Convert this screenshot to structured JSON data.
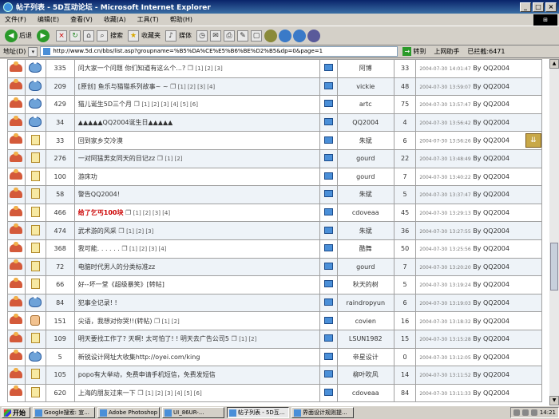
{
  "window": {
    "title": "帖子列表 - 5D互动论坛 - Microsoft Internet Explorer"
  },
  "menu": [
    "文件(F)",
    "编辑(E)",
    "查看(V)",
    "收藏(A)",
    "工具(T)",
    "帮助(H)"
  ],
  "toolbar": {
    "back": "后退",
    "search": "搜索",
    "favorites": "收藏夹",
    "media": "媒体"
  },
  "address": {
    "label": "地址(D)",
    "url": "http://www.5d.cn/bbs/list.asp?groupname=%B5%DA%CE%E5%B6%BE%D2%B5&dp=0&page=1",
    "go": "转到",
    "help": "上网助手",
    "blocked": "已拦截:6471"
  },
  "rows": [
    {
      "id": 335,
      "title": "问大家一个问题 你们知道有这么个...?",
      "pages": "[1] [2] [3]",
      "author": "阿博",
      "replies": 33,
      "date": "2004-07-30",
      "time": "14:01:47",
      "by": "By QQ2004",
      "icon": "face"
    },
    {
      "id": 209,
      "title": "[原创]  鱼乐与猫猫系列故事~ ~",
      "pages": "[1] [2] [3] [4]",
      "author": "vickie",
      "replies": 48,
      "date": "2004-07-30",
      "time": "13:59:07",
      "by": "By QQ2004",
      "icon": "face"
    },
    {
      "id": 429,
      "title": "猫儿诞生5D三个月",
      "pages": "[1] [2] [3] [4] [5] [6]",
      "author": "artc",
      "replies": 75,
      "date": "2004-07-30",
      "time": "13:57:47",
      "by": "By QQ2004",
      "icon": "face"
    },
    {
      "id": 34,
      "title": "▲▲▲▲▲QQ2004诞生日▲▲▲▲▲",
      "pages": "",
      "author": "QQ2004",
      "replies": 4,
      "date": "2004-07-30",
      "time": "13:56:42",
      "by": "By QQ2004",
      "icon": "face"
    },
    {
      "id": 33,
      "title": "回到家乡交冷漠",
      "pages": "",
      "author": "朱斌",
      "replies": 6,
      "date": "2004-07-30",
      "time": "13:56:26",
      "by": "By QQ2004",
      "icon": "doc",
      "down": true
    },
    {
      "id": 276,
      "title": "一对阿猛男女同天的日记zz",
      "pages": "[1] [2]",
      "author": "gourd",
      "replies": 22,
      "date": "2004-07-30",
      "time": "13:48:49",
      "by": "By QQ2004",
      "icon": "doc"
    },
    {
      "id": 100,
      "title": "游床功",
      "pages": "",
      "author": "gourd",
      "replies": 7,
      "date": "2004-07-30",
      "time": "13:40:22",
      "by": "By QQ2004",
      "icon": "doc"
    },
    {
      "id": 58,
      "title": "警告QQ2004!",
      "pages": "",
      "author": "朱斌",
      "replies": 5,
      "date": "2004-07-30",
      "time": "13:37:47",
      "by": "By QQ2004",
      "icon": "doc"
    },
    {
      "id": 466,
      "title": "给了乞丐100块",
      "pages": "[1] [2] [3] [4]",
      "author": "cdoveaa",
      "replies": 45,
      "date": "2004-07-30",
      "time": "13:29:13",
      "by": "By QQ2004",
      "icon": "doc",
      "hot": true
    },
    {
      "id": 474,
      "title": "武术游的风采",
      "pages": "[1] [2] [3]",
      "author": "朱斌",
      "replies": 36,
      "date": "2004-07-30",
      "time": "13:27:55",
      "by": "By QQ2004",
      "icon": "doc"
    },
    {
      "id": 368,
      "title": "我可能. . . . . .",
      "pages": "[1] [2] [3] [4]",
      "author": "酷舞",
      "replies": 50,
      "date": "2004-07-30",
      "time": "13:25:56",
      "by": "By QQ2004",
      "icon": "doc"
    },
    {
      "id": 72,
      "title": "电脑时代男人的分类标准zz",
      "pages": "",
      "author": "gourd",
      "replies": 7,
      "date": "2004-07-30",
      "time": "13:20:20",
      "by": "By QQ2004",
      "icon": "doc"
    },
    {
      "id": 66,
      "title": "好--坏一堂《超级暴笑》[转帖]",
      "pages": "",
      "author": "秋天的树",
      "replies": 5,
      "date": "2004-07-30",
      "time": "13:19:24",
      "by": "By QQ2004",
      "icon": "doc"
    },
    {
      "id": 84,
      "title": "犯事全记录! !",
      "pages": "",
      "author": "raindropyun",
      "replies": 6,
      "date": "2004-07-30",
      "time": "13:19:03",
      "by": "By QQ2004",
      "icon": "face"
    },
    {
      "id": 151,
      "title": "尖语，我想对你哭!!(转帖)",
      "pages": "[1] [2]",
      "author": "covien",
      "replies": 16,
      "date": "2004-07-30",
      "time": "13:18:32",
      "by": "By QQ2004",
      "icon": "thumb"
    },
    {
      "id": 109,
      "title": "明天要找工作了? 天啊! 太可怕了! ! 明天去广告公司5",
      "pages": "[1] [2]",
      "author": "LSUN1982",
      "replies": 15,
      "date": "2004-07-30",
      "time": "13:15:28",
      "by": "By QQ2004",
      "icon": "doc"
    },
    {
      "id": 5,
      "title": "新锐设计网址大收集http://oyei.com/king",
      "pages": "",
      "author": "帝星设计",
      "replies": 0,
      "date": "2004-07-30",
      "time": "13:12:05",
      "by": "By QQ2004",
      "icon": "face"
    },
    {
      "id": 105,
      "title": "popo有大举动，免费申请手机短信，免费发短信",
      "pages": "",
      "author": "柳叶吹风",
      "replies": 14,
      "date": "2004-07-30",
      "time": "13:11:52",
      "by": "By QQ2004",
      "icon": "doc"
    },
    {
      "id": 620,
      "title": "上海的朋友过来一下",
      "pages": "[1] [2] [3] [4] [5] [6]",
      "author": "cdoveaa",
      "replies": 84,
      "date": "2004-07-30",
      "time": "13:11:33",
      "by": "By QQ2004",
      "icon": "doc"
    }
  ],
  "taskbar": {
    "start": "开始",
    "tasks": [
      "Google搜索: 宣...",
      "Adobe Photoshop",
      "UI_86UR-...",
      "帖子列表 - 5D互...",
      "界面设计规则提..."
    ],
    "clock": "14:21"
  }
}
